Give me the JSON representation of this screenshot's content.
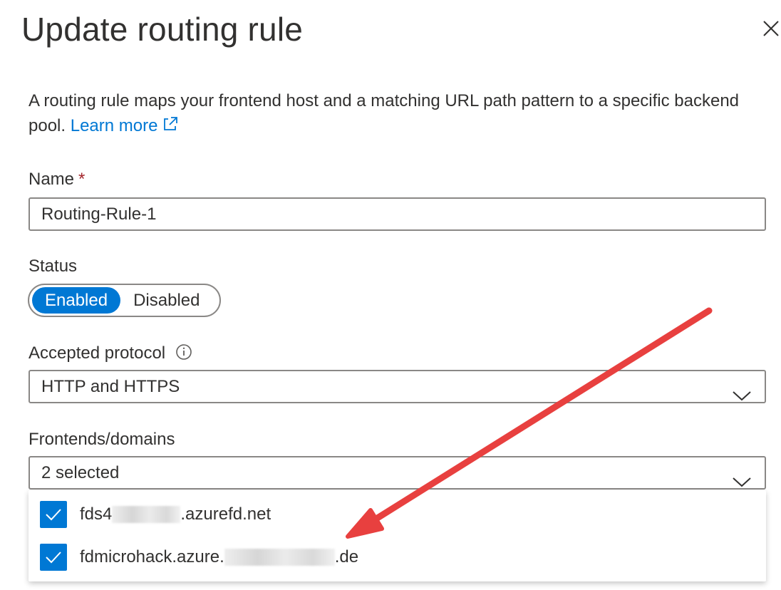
{
  "panel": {
    "title": "Update routing rule",
    "description": "A routing rule maps your frontend host and a matching URL path pattern to a specific backend pool.",
    "learn_more": "Learn more"
  },
  "name_field": {
    "label": "Name",
    "required_mark": "*",
    "value": "Routing-Rule-1"
  },
  "status": {
    "label": "Status",
    "options": [
      "Enabled",
      "Disabled"
    ],
    "selected": "Enabled"
  },
  "protocol": {
    "label": "Accepted protocol",
    "value": "HTTP and HTTPS"
  },
  "frontends": {
    "label": "Frontends/domains",
    "value": "2 selected",
    "options": [
      {
        "prefix": "fds4",
        "suffix": ".azurefd.net",
        "checked": true
      },
      {
        "prefix": "fdmicrohack.azure.",
        "suffix": ".de",
        "checked": true
      }
    ]
  },
  "colors": {
    "accent": "#0078d4",
    "annotation_arrow": "#e8403f",
    "required": "#a4262c"
  }
}
